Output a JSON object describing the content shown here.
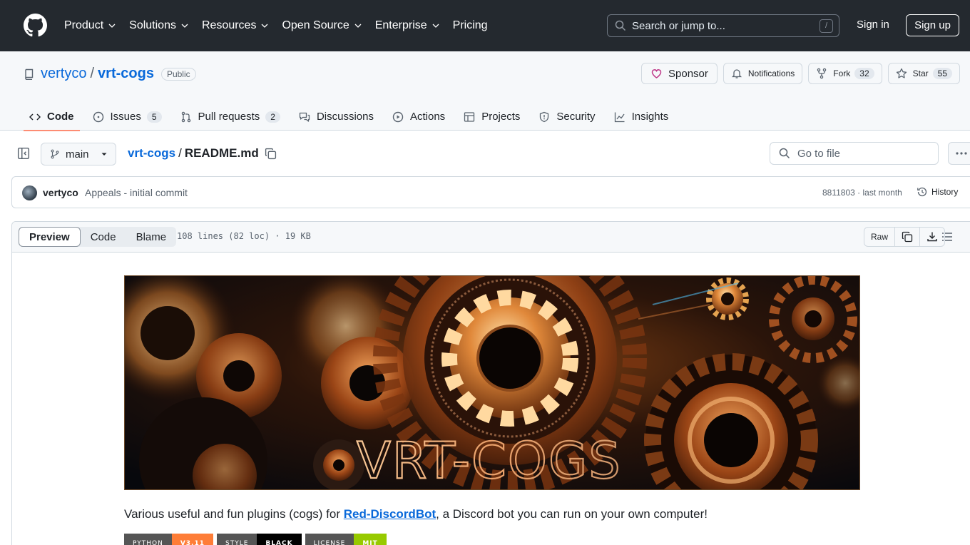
{
  "header": {
    "nav": [
      {
        "label": "Product",
        "has_menu": true
      },
      {
        "label": "Solutions",
        "has_menu": true
      },
      {
        "label": "Resources",
        "has_menu": true
      },
      {
        "label": "Open Source",
        "has_menu": true
      },
      {
        "label": "Enterprise",
        "has_menu": true
      },
      {
        "label": "Pricing",
        "has_menu": false
      }
    ],
    "search_placeholder": "Search or jump to...",
    "search_shortcut": "/",
    "sign_in": "Sign in",
    "sign_up": "Sign up"
  },
  "repo": {
    "owner": "vertyco",
    "separator": "/",
    "name": "vrt-cogs",
    "visibility": "Public",
    "sponsor": "Sponsor",
    "notifications": "Notifications",
    "fork_label": "Fork",
    "fork_count": "32",
    "star_label": "Star",
    "star_count": "55"
  },
  "tabs": [
    {
      "label": "Code",
      "icon": "code-icon",
      "count": null,
      "active": true
    },
    {
      "label": "Issues",
      "icon": "issue-icon",
      "count": "5",
      "active": false
    },
    {
      "label": "Pull requests",
      "icon": "pull-request-icon",
      "count": "2",
      "active": false
    },
    {
      "label": "Discussions",
      "icon": "discussion-icon",
      "count": null,
      "active": false
    },
    {
      "label": "Actions",
      "icon": "play-icon",
      "count": null,
      "active": false
    },
    {
      "label": "Projects",
      "icon": "table-icon",
      "count": null,
      "active": false
    },
    {
      "label": "Security",
      "icon": "shield-icon",
      "count": null,
      "active": false
    },
    {
      "label": "Insights",
      "icon": "graph-icon",
      "count": null,
      "active": false
    }
  ],
  "file": {
    "branch": "main",
    "repo_crumb": "vrt-cogs",
    "crumb_sep": "/",
    "filename": "README.md",
    "goto_placeholder": "Go to file"
  },
  "commit": {
    "author": "vertyco",
    "message": "Appeals - initial commit",
    "meta": "8811803 · last month",
    "history": "History"
  },
  "viewer": {
    "modes": [
      "Preview",
      "Code",
      "Blame"
    ],
    "active_mode": "Preview",
    "info": "108 lines (82 loc) · 19 KB",
    "raw": "Raw"
  },
  "readme": {
    "banner_text": "VRT-COGS",
    "desc_before": "Various useful and fun plugins (cogs) for ",
    "desc_link": "Red-DiscordBot",
    "desc_after": ", a Discord bot you can run on your own computer!",
    "badges": [
      {
        "left": "PYTHON",
        "right": "V3.11",
        "color": "#fe7d37"
      },
      {
        "left": "STYLE",
        "right": "BLACK",
        "color": "#000000"
      },
      {
        "left": "LICENSE",
        "right": "MIT",
        "color": "#97ca00"
      }
    ]
  },
  "colors": {
    "header_bg": "#24292f",
    "link": "#0969da",
    "tab_underline": "#fd8c73",
    "sponsor_heart": "#bf3989"
  }
}
